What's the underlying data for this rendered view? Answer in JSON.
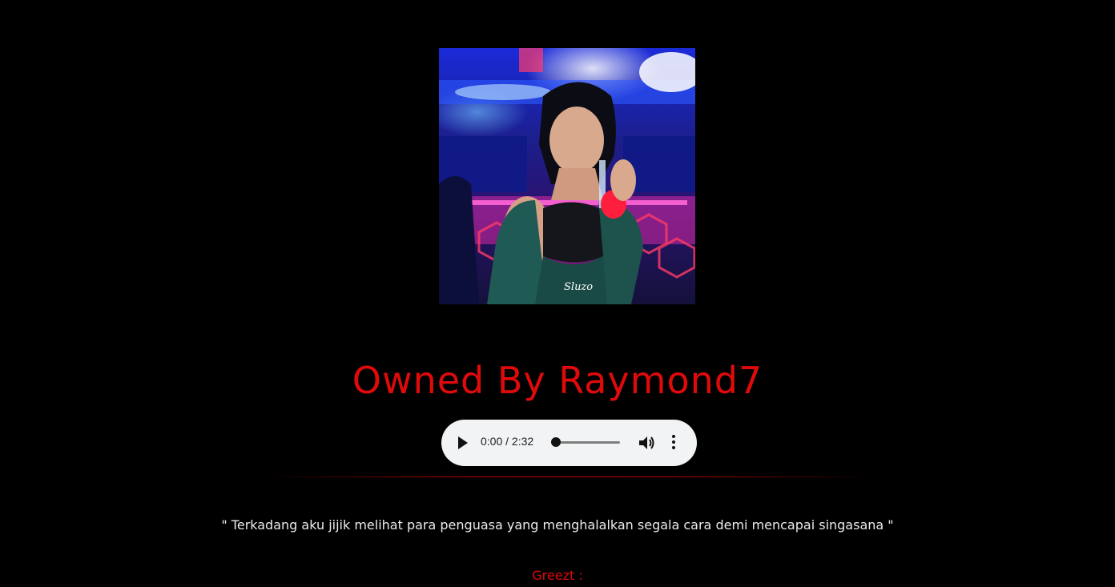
{
  "header": {
    "title": "Owned By Raymond7"
  },
  "photo": {
    "watermark": "Sluzo"
  },
  "audio_player": {
    "time": "0:00 / 2:32",
    "progress": 0
  },
  "quote": "\" Terkadang aku jijik melihat para penguasa yang menghalalkan segala cara demi mencapai singasana \"",
  "greetings_label": "Greezt :",
  "colors": {
    "background": "#000000",
    "accent": "#e00a0a",
    "text": "#ececec",
    "player_bg": "#f1f3f4"
  }
}
